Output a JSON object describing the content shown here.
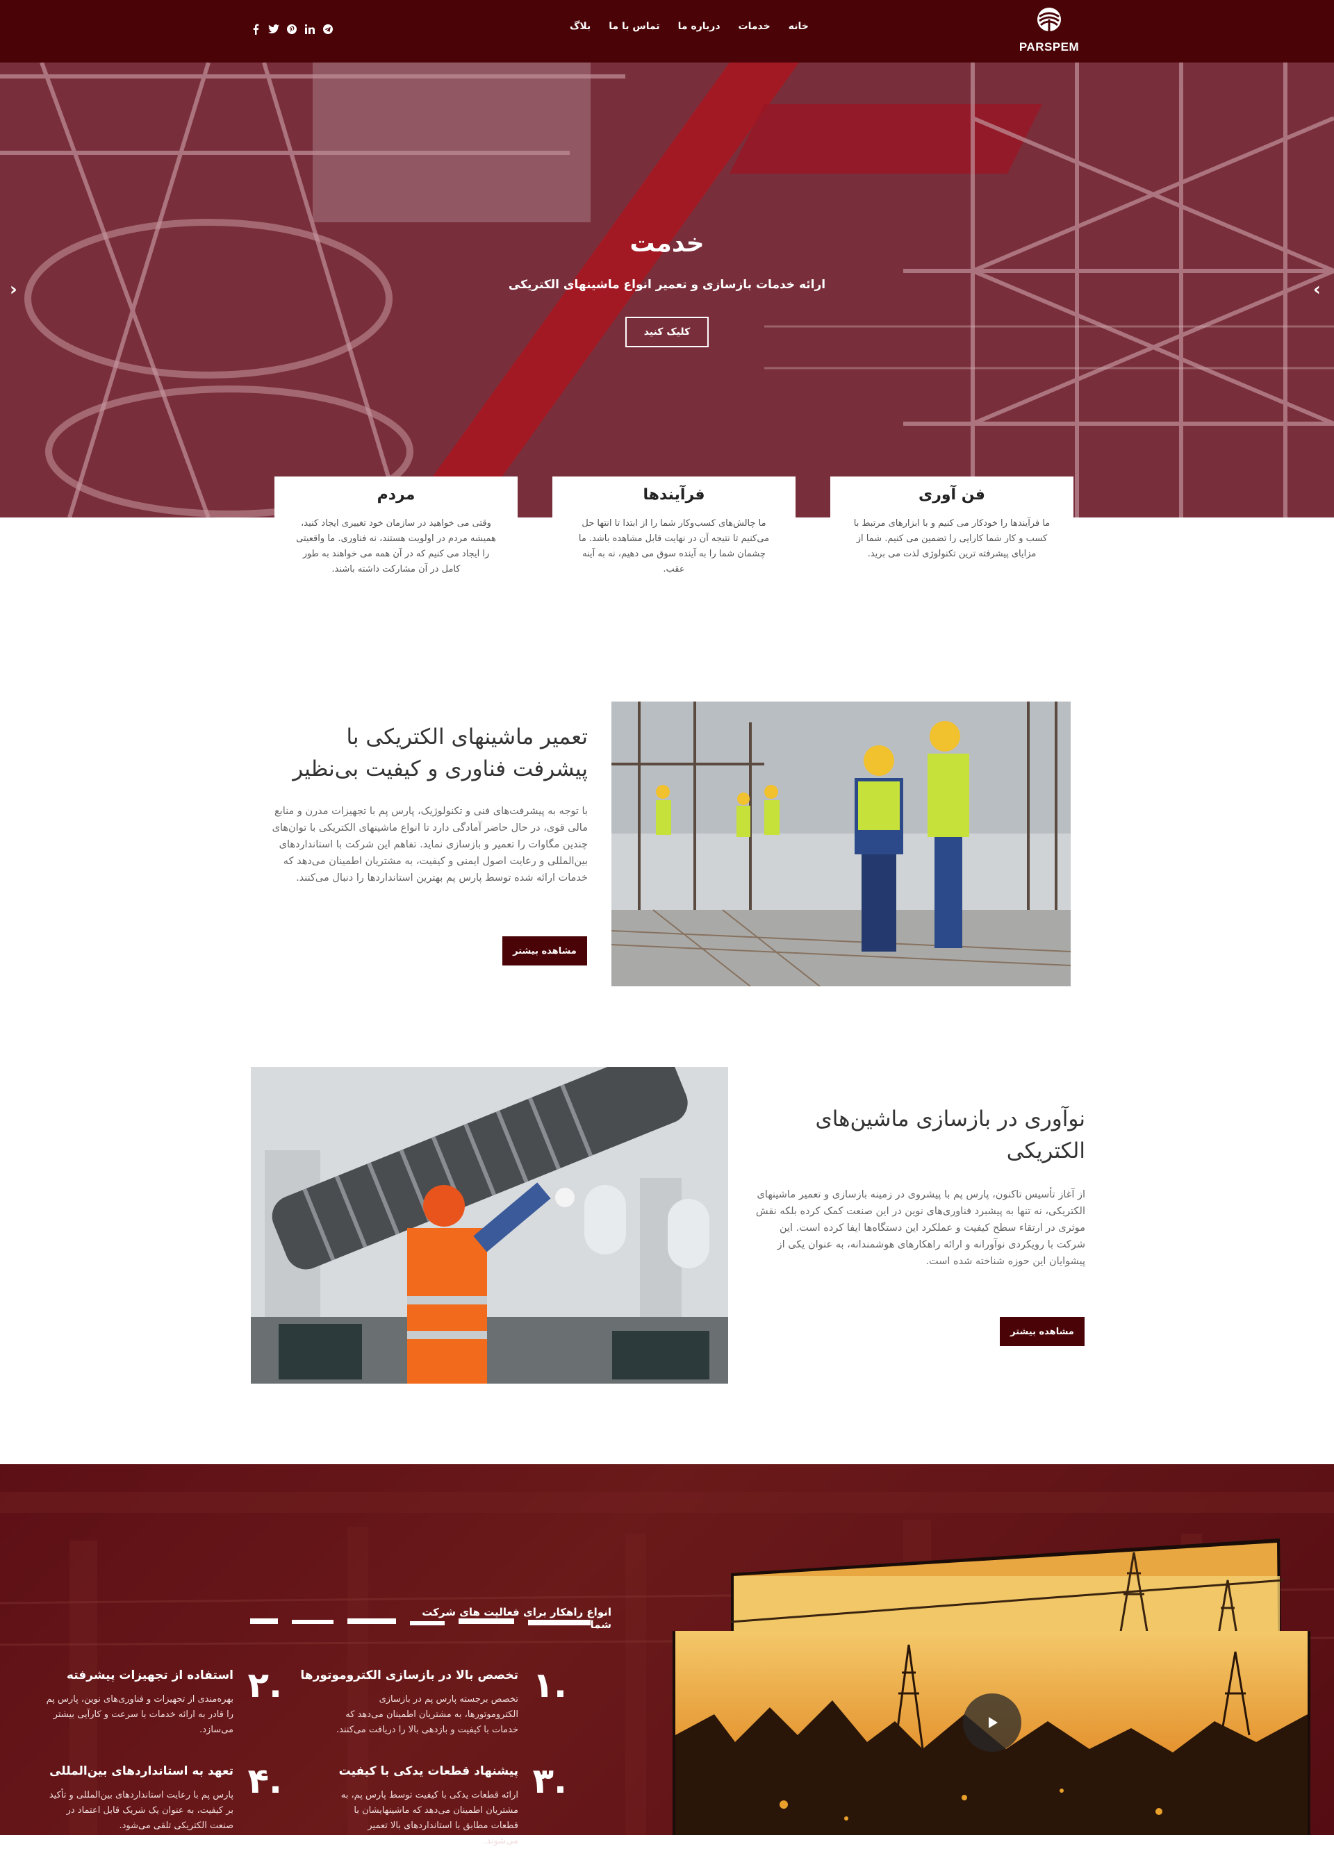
{
  "colors": {
    "brand": "#4a0407",
    "white": "#ffffff",
    "text_gray": "#666666"
  },
  "header": {
    "logo_text": "PARSPEM",
    "nav": [
      {
        "label": "خانه"
      },
      {
        "label": "خدمات"
      },
      {
        "label": "درباره ما"
      },
      {
        "label": "تماس با ما"
      },
      {
        "label": "بلاگ"
      }
    ],
    "social_icons": [
      "facebook-icon",
      "twitter-icon",
      "pinterest-icon",
      "linkedin-icon",
      "telegram-icon"
    ]
  },
  "hero": {
    "title": "خدمت",
    "subtitle": "ارائه خدمات بازسازی و تعمیر انواع ماشینهای الکتریکی",
    "button": "کلیک کنید",
    "prev_icon": "chevron-left-icon",
    "next_icon": "chevron-right-icon"
  },
  "cards": [
    {
      "title": "فن آوری",
      "text": "ما فرآیندها را خودکار می کنیم و با ابزارهای مرتبط با کسب و کار شما کارایی را تضمین می کنیم. شما از مزایای پیشرفته ترین تکنولوژی لذت می برید."
    },
    {
      "title": "فرآیندها",
      "text": "ما چالش‌های کسب‌وکار شما را از ابتدا تا انتها حل می‌کنیم تا نتیجه آن در نهایت قابل مشاهده باشد. ما چشمان شما را به آینده سوق می دهیم، نه به آینه عقب."
    },
    {
      "title": "مردم",
      "text": "وقتی می خواهید در سازمان خود تغییری ایجاد کنید، همیشه مردم در اولویت هستند، نه فناوری. ما واقعیتی را ایجاد می کنیم که در آن همه می خواهند به طور کامل در آن مشارکت داشته باشند."
    }
  ],
  "section1": {
    "title_line1": "تعمیر ماشینهای الکتریکی با",
    "title_line2": "پیشرفت فناوری و کیفیت بی‌نظیر",
    "text": "با توجه به پیشرفت‌های فنی و تکنولوژیک، پارس پم با تجهیزات مدرن و منابع مالی قوی، در حال حاضر آمادگی دارد تا انواع ماشینهای الکتریکی با توان‌های چندین مگاوات را تعمیر و بازسازی نماید. تفاهم این شرکت با استانداردهای بین‌المللی و رعایت اصول ایمنی و کیفیت، به مشتریان اطمینان می‌دهد که خدمات ارائه شده توسط پارس پم بهترین استانداردها را دنبال می‌کنند.",
    "button": "مشاهده بیشتر"
  },
  "section2": {
    "title_line1": "نوآوری در بازسازی ماشین‌های",
    "title_line2": "الکتریکی",
    "text": "از آغاز تأسیس تاکنون، پارس پم با پیشروی در زمینه بازسازی و تعمیر ماشینهای الکتریکی، نه تنها به پیشبرد فناوری‌های نوین در این صنعت کمک کرده بلکه نقش موثری در ارتقاء سطح کیفیت و عملکرد این دستگاه‌ها ایفا کرده است. این شرکت با رویکردی نوآورانه و ارائه راهکارهای هوشمندانه، به عنوان یکی از پیشوایان این حوزه شناخته شده است.",
    "button": "مشاهده بیشتر"
  },
  "band": {
    "heading": "انواع راهکار برای فعالیت های شرکت شما",
    "items": [
      {
        "num": ".۱",
        "title": "تخصص بالا در بازسازی الکتروموتورها",
        "text": "تخصص برجسته پارس پم در بازسازی الکتروموتورها، به مشتریان اطمینان می‌دهد که خدمات با کیفیت و بازدهی بالا را دریافت می‌کنند."
      },
      {
        "num": ".۲",
        "title": "استفاده از تجهیزات پیشرفته",
        "text": "بهره‌مندی از تجهیزات و فناوری‌های نوین، پارس پم را قادر به ارائه خدمات با سرعت و کارآیی بیشتر می‌سازد."
      },
      {
        "num": ".۳",
        "title": "پیشنهاد قطعات یدکی با کیفیت",
        "text": "ارائه قطعات یدکی با کیفیت توسط پارس پم، به مشتریان اطمینان می‌دهد که ماشینهایشان با قطعات مطابق با استانداردهای بالا تعمیر می‌شوند."
      },
      {
        "num": ".۴",
        "title": "تعهد به استانداردهای بین‌المللی",
        "text": "پارس پم با رعایت استانداردهای بین‌المللی و تأکید بر کیفیت، به عنوان یک شریک قابل اعتماد در صنعت الکتریکی تلقی می‌شود."
      }
    ],
    "play_icon": "play-icon"
  }
}
